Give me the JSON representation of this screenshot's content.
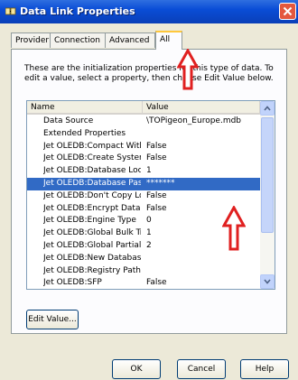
{
  "window": {
    "title": "Data Link Properties",
    "colors": {
      "titlebar": "#0a4dd6",
      "selection": "#316ac5",
      "arrow": "#e02020"
    }
  },
  "tabs": [
    {
      "label": "Provider"
    },
    {
      "label": "Connection"
    },
    {
      "label": "Advanced"
    },
    {
      "label": "All",
      "active": true
    }
  ],
  "panel": {
    "instructions": "These are the initialization properties for this type of data. To edit a value, select a property, then choose Edit Value below.",
    "columns": {
      "name": "Name",
      "value": "Value"
    },
    "rows": [
      {
        "name": "Data Source",
        "value": "\\TOPigeon_Europe.mdb"
      },
      {
        "name": "Extended Properties",
        "value": ""
      },
      {
        "name": "Jet OLEDB:Compact With...",
        "value": "False"
      },
      {
        "name": "Jet OLEDB:Create System...",
        "value": "False"
      },
      {
        "name": "Jet OLEDB:Database Loc...",
        "value": "1"
      },
      {
        "name": "Jet OLEDB:Database Pas...",
        "value": "*******",
        "selected": true
      },
      {
        "name": "Jet OLEDB:Don't Copy Lo...",
        "value": "False"
      },
      {
        "name": "Jet OLEDB:Encrypt Datab...",
        "value": "False"
      },
      {
        "name": "Jet OLEDB:Engine Type",
        "value": "0"
      },
      {
        "name": "Jet OLEDB:Global Bulk Tr...",
        "value": "1"
      },
      {
        "name": "Jet OLEDB:Global Partial ...",
        "value": "2"
      },
      {
        "name": "Jet OLEDB:New Database...",
        "value": ""
      },
      {
        "name": "Jet OLEDB:Registry Path",
        "value": ""
      },
      {
        "name": "Jet OLEDB:SFP",
        "value": "False"
      }
    ],
    "edit_button": "Edit Value..."
  },
  "footer": {
    "ok": "OK",
    "cancel": "Cancel",
    "help": "Help"
  },
  "icons": [
    "data-link-icon",
    "close-icon",
    "scroll-up-icon",
    "scroll-down-icon",
    "red-arrow-icon"
  ]
}
